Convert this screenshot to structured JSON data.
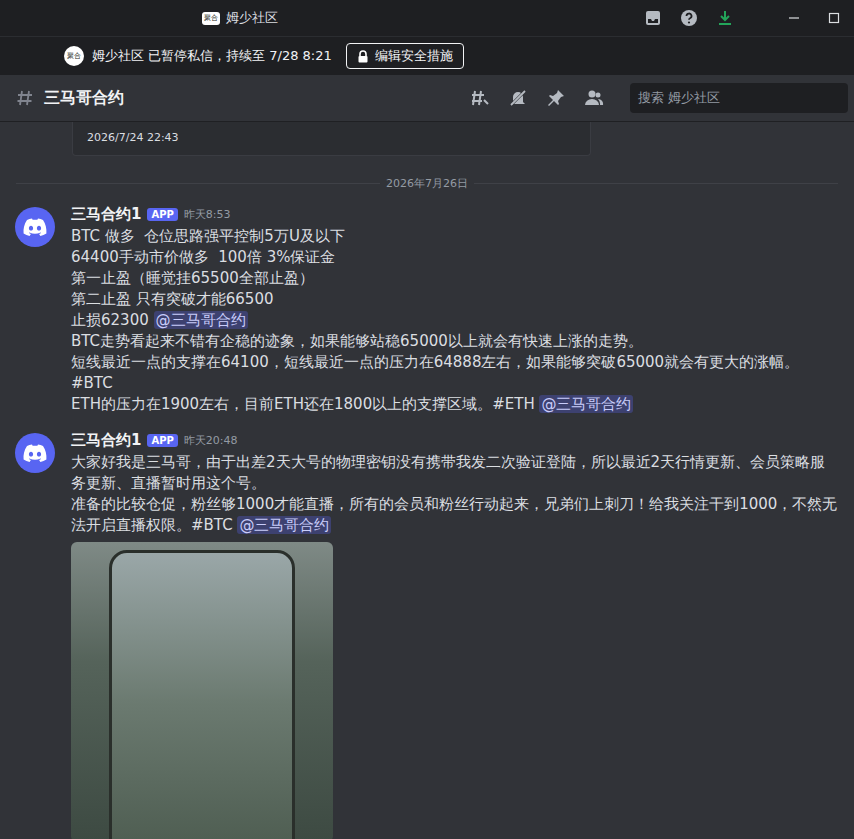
{
  "window": {
    "logo": "聚合",
    "title": "姆少社区"
  },
  "notice": {
    "server_icon": "聚合",
    "text": "姆少社区 已暂停私信，持续至 7/28 8:21",
    "button": "编辑安全措施"
  },
  "channel": {
    "name": "三马哥合约",
    "search_placeholder": "搜索 姆少社区"
  },
  "prev_embed": {
    "time": "2026/7/24 22:43"
  },
  "date_divider": "2026年7月26日",
  "messages": [
    {
      "author": "三马合约1",
      "badge": "APP",
      "time": "昨天8:53",
      "has_photo": false,
      "lines": [
        [
          {
            "kind": "text",
            "text": "BTC 做多  仓位思路强平控制5万U及以下"
          }
        ],
        [
          {
            "kind": "text",
            "text": "64400手动市价做多  100倍 3%保证金"
          }
        ],
        [
          {
            "kind": "text",
            "text": "第一止盈（睡觉挂65500全部止盈）"
          }
        ],
        [
          {
            "kind": "text",
            "text": "第二止盈 只有突破才能66500"
          }
        ],
        [
          {
            "kind": "text",
            "text": "止损62300 "
          },
          {
            "kind": "mention",
            "text": "@三马哥合约"
          }
        ],
        [
          {
            "kind": "text",
            "text": "BTC走势看起来不错有企稳的迹象，如果能够站稳65000以上就会有快速上涨的走势。"
          }
        ],
        [
          {
            "kind": "text",
            "text": "短线最近一点的支撑在64100，短线最近一点的压力在64888左右，如果能够突破65000就会有更大的涨幅。"
          }
        ],
        [
          {
            "kind": "text",
            "text": "#BTC"
          }
        ],
        [
          {
            "kind": "text",
            "text": "ETH的压力在1900左右，目前ETH还在1800以上的支撑区域。#ETH "
          },
          {
            "kind": "mention",
            "text": "@三马哥合约"
          }
        ]
      ]
    },
    {
      "author": "三马合约1",
      "badge": "APP",
      "time": "昨天20:48",
      "has_photo": true,
      "lines": [
        [
          {
            "kind": "text",
            "text": "大家好我是三马哥，由于出差2天大号的物理密钥没有携带我发二次验证登陆，所以最近2天行情更新、会员策略服务更新、直播暂时用这个号。"
          }
        ],
        [
          {
            "kind": "text",
            "text": "准备的比较仓促，粉丝够1000才能直播，所有的会员和粉丝行动起来，兄弟们上刺刀！给我关注干到1000，不然无法开启直播权限。#BTC "
          },
          {
            "kind": "mention",
            "text": "@三马哥合约"
          }
        ]
      ]
    }
  ]
}
